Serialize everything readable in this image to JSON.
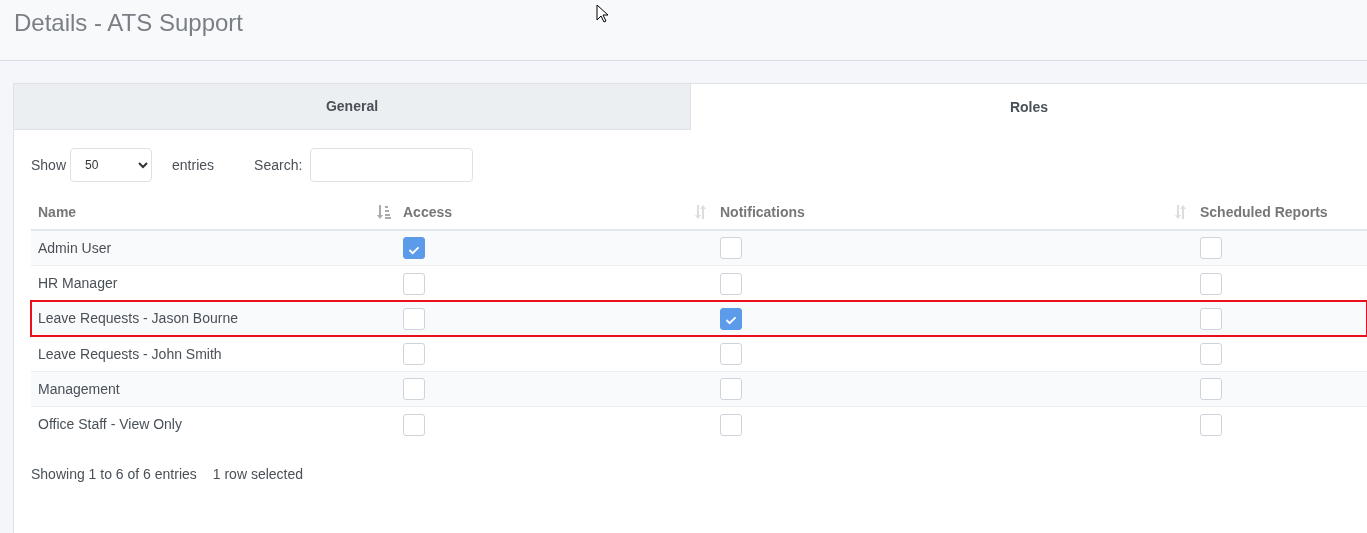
{
  "page_title": "Details - ATS Support",
  "tabs": [
    {
      "label": "General",
      "selected": false
    },
    {
      "label": "Roles",
      "selected": true
    }
  ],
  "length_control": {
    "before": "Show",
    "value": "50",
    "after": "entries"
  },
  "search": {
    "label": "Search:"
  },
  "table": {
    "columns": [
      {
        "label": "Name",
        "sorted": true
      },
      {
        "label": "Access",
        "sorted": false
      },
      {
        "label": "Notifications",
        "sorted": false
      },
      {
        "label": "Scheduled Reports"
      }
    ],
    "rows": [
      {
        "name": "Admin User",
        "access": true,
        "notifications": false,
        "scheduled_reports": false,
        "selected": false
      },
      {
        "name": "HR Manager",
        "access": false,
        "notifications": false,
        "scheduled_reports": false,
        "selected": false
      },
      {
        "name": "Leave Requests - Jason Bourne",
        "access": false,
        "notifications": true,
        "scheduled_reports": false,
        "selected": true
      },
      {
        "name": "Leave Requests - John Smith",
        "access": false,
        "notifications": false,
        "scheduled_reports": false,
        "selected": false
      },
      {
        "name": "Management",
        "access": false,
        "notifications": false,
        "scheduled_reports": false,
        "selected": false
      },
      {
        "name": "Office Staff - View Only",
        "access": false,
        "notifications": false,
        "scheduled_reports": false,
        "selected": false
      }
    ]
  },
  "info": "Showing 1 to 6 of 6 entries",
  "selection_info": "1 row selected"
}
